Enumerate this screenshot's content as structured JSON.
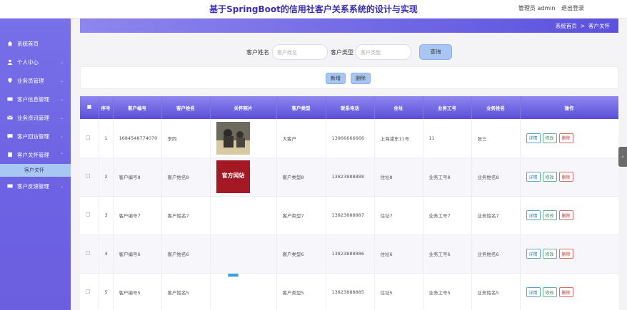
{
  "header": {
    "title": "基于SpringBoot的信用社客户关系系统的设计与实现",
    "user_label": "管理员 admin",
    "logout_label": "退出登录"
  },
  "sidebar": {
    "items": [
      {
        "label": "系统首页",
        "icon": "home-icon"
      },
      {
        "label": "个人中心",
        "icon": "user-icon"
      },
      {
        "label": "业务员管理",
        "icon": "briefcase-icon"
      },
      {
        "label": "客户信息管理",
        "icon": "card-icon"
      },
      {
        "label": "业务资讯管理",
        "icon": "mail-icon"
      },
      {
        "label": "客户回访管理",
        "icon": "chat-icon"
      },
      {
        "label": "客户关怀管理",
        "icon": "heart-icon"
      },
      {
        "label": "客户反馈管理",
        "icon": "feedback-icon"
      }
    ],
    "active_sub": "客户关怀"
  },
  "breadcrumb": {
    "home": "系统首页",
    "sep": ">",
    "current": "客户关怀"
  },
  "search": {
    "name_label": "客户姓名",
    "name_placeholder": "客户姓名",
    "type_label": "客户类型",
    "type_placeholder": "客户类型",
    "query_label": "查询"
  },
  "toolbar": {
    "add_label": "新增",
    "delete_label": "删除"
  },
  "table": {
    "headers": [
      "",
      "序号",
      "客户编号",
      "客户姓名",
      "关怀照片",
      "客户类型",
      "联系电话",
      "住址",
      "业务工号",
      "业务姓名",
      "操作"
    ],
    "rows": [
      {
        "no": "1",
        "code": "1684548774070",
        "name": "李四",
        "photo": "photo-office",
        "type": "大客户",
        "phone": "13966666666",
        "addr": "上海浦东11号",
        "staff_no": "11",
        "staff_name": "张三"
      },
      {
        "no": "2",
        "code": "客户编号8",
        "name": "客户姓名8",
        "photo": "photo-red",
        "photo_text": "官方网站",
        "type": "客户类型8",
        "phone": "13823888888",
        "addr": "住址8",
        "staff_no": "业务工号8",
        "staff_name": "业务姓名8"
      },
      {
        "no": "3",
        "code": "客户编号7",
        "name": "客户姓名7",
        "photo": "",
        "type": "客户类型7",
        "phone": "13823888887",
        "addr": "住址7",
        "staff_no": "业务工号7",
        "staff_name": "业务姓名7"
      },
      {
        "no": "4",
        "code": "客户编号6",
        "name": "客户姓名6",
        "photo": "",
        "type": "客户类型6",
        "phone": "13823888886",
        "addr": "住址6",
        "staff_no": "业务工号6",
        "staff_name": "业务姓名6"
      },
      {
        "no": "5",
        "code": "客户编号5",
        "name": "客户姓名5",
        "photo": "photo-blue",
        "type": "客户类型5",
        "phone": "13823888885",
        "addr": "住址5",
        "staff_no": "业务工号5",
        "staff_name": "业务姓名5"
      }
    ],
    "ops": {
      "detail": "详情",
      "edit": "修改",
      "delete": "删除"
    }
  },
  "colors": {
    "accent": "#6b5fe0",
    "header_start": "#8f86ef",
    "header_end": "#5a4ed8",
    "button": "#a8c6f1"
  }
}
